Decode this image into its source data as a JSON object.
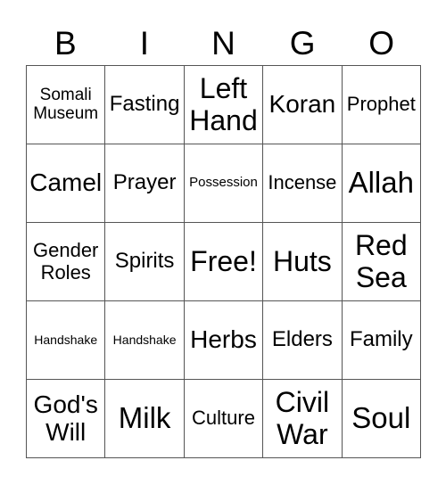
{
  "header": [
    "B",
    "I",
    "N",
    "G",
    "O"
  ],
  "cells": [
    [
      "Somali Museum",
      "Fasting",
      "Left Hand",
      "Koran",
      "Prophet"
    ],
    [
      "Camel",
      "Prayer",
      "Possession",
      "Incense",
      "Allah"
    ],
    [
      "Gender Roles",
      "Spirits",
      "Free!",
      "Huts",
      "Red Sea"
    ],
    [
      "Handshake",
      "Handshake",
      "Herbs",
      "Elders",
      "Family"
    ],
    [
      "God's Will",
      "Milk",
      "Culture",
      "Civil War",
      "Soul"
    ]
  ]
}
